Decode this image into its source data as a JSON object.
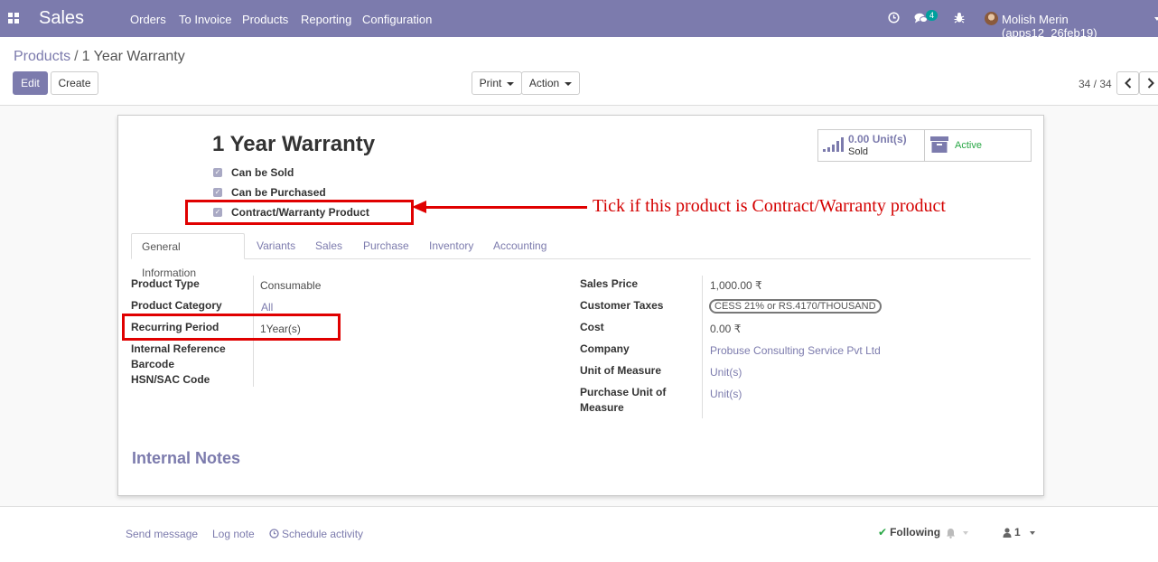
{
  "navbar": {
    "app_name": "Sales",
    "menu": [
      "Orders",
      "To Invoice",
      "Products",
      "Reporting",
      "Configuration"
    ],
    "message_count": "4",
    "user": "Molish Merin (apps12_26feb19)"
  },
  "breadcrumb": {
    "parent": "Products",
    "separator": "/",
    "current": "1 Year Warranty"
  },
  "buttons": {
    "edit": "Edit",
    "create": "Create",
    "print": "Print",
    "action": "Action"
  },
  "pager": {
    "value": "34 / 34"
  },
  "product": {
    "name": "1 Year Warranty",
    "checkboxes": [
      "Can be Sold",
      "Can be Purchased",
      "Contract/Warranty Product"
    ],
    "stat": {
      "value": "0.00 Unit(s)",
      "label": "Sold"
    },
    "active_label": "Active"
  },
  "annotation": {
    "text": "Tick if this product is Contract/Warranty product"
  },
  "tabs": [
    "General Information",
    "Variants",
    "Sales",
    "Purchase",
    "Inventory",
    "Accounting"
  ],
  "left_fields": [
    {
      "label": "Product Type",
      "value": "Consumable"
    },
    {
      "label": "Product Category",
      "value": "All"
    },
    {
      "label": "Recurring Period",
      "value": "1Year(s)"
    },
    {
      "label": "Internal Reference",
      "value": ""
    },
    {
      "label": "Barcode",
      "value": ""
    },
    {
      "label": "HSN/SAC Code",
      "value": ""
    }
  ],
  "right_fields": [
    {
      "label": "Sales Price",
      "value": "1,000.00 ₹"
    },
    {
      "label": "Customer Taxes",
      "value": "CESS 21% or RS.4170/THOUSAND"
    },
    {
      "label": "Cost",
      "value": "0.00 ₹"
    },
    {
      "label": "Company",
      "value": "Probuse Consulting Service Pvt Ltd"
    },
    {
      "label": "Unit of Measure",
      "value": "Unit(s)"
    },
    {
      "label": "Purchase Unit of Measure",
      "value": "Unit(s)"
    }
  ],
  "notes_title": "Internal Notes",
  "chatter": {
    "send_message": "Send message",
    "log_note": "Log note",
    "schedule_activity": "Schedule activity",
    "following": "Following",
    "followers_count": "1"
  },
  "colors": {
    "navbar": "#7c7bad",
    "annotation_red": "#e00000",
    "link": "#7c7bad"
  }
}
